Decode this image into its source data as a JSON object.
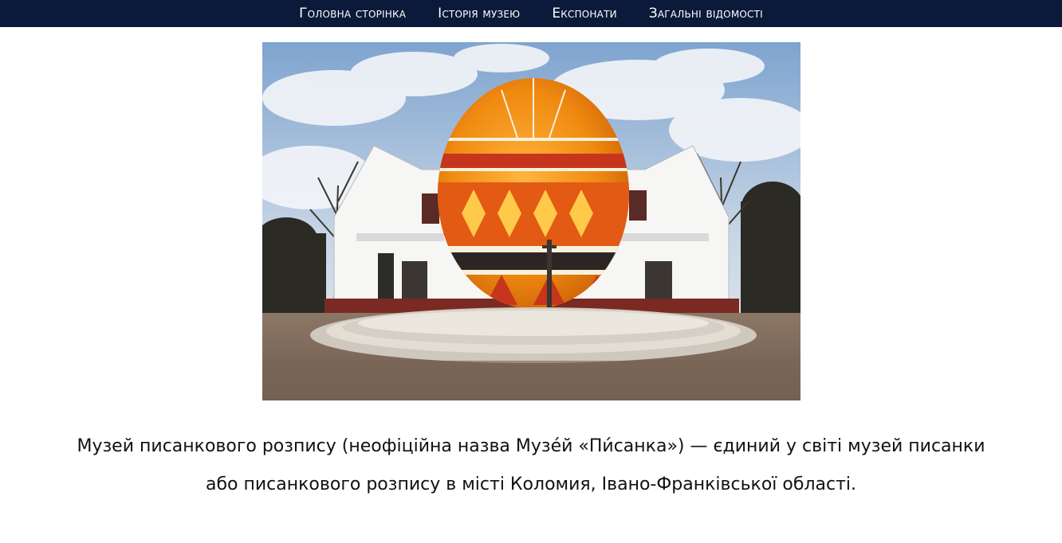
{
  "nav": {
    "items": [
      {
        "label": "Головна сторінка"
      },
      {
        "label": "Історія музею"
      },
      {
        "label": "Експонати"
      },
      {
        "label": "Загальні відомості"
      }
    ]
  },
  "colors": {
    "nav_background": "#0b1a3a",
    "nav_text": "#ffffff",
    "page_background": "#ffffff"
  },
  "main": {
    "description": "Музей писанкового розпису (неофіційна назва Музе́й «Пи́санка») — єдиний у світі музей писанки або писанкового розпису в місті Коломия, Івано-Франківської області."
  }
}
